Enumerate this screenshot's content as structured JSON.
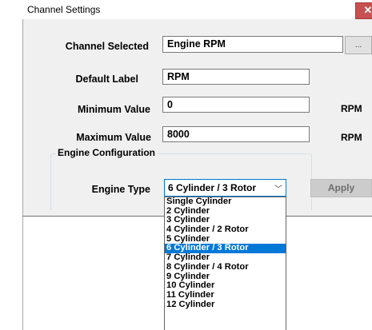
{
  "window": {
    "title": "Channel Settings",
    "close_glyph": "✕"
  },
  "form": {
    "channel_selected": {
      "label": "Channel Selected",
      "value": "Engine RPM",
      "browse_label": "..."
    },
    "default_label": {
      "label": "Default Label",
      "value": "RPM"
    },
    "minimum_value": {
      "label": "Minimum Value",
      "value": "0",
      "unit": "RPM"
    },
    "maximum_value": {
      "label": "Maximum Value",
      "value": "8000",
      "unit": "RPM"
    }
  },
  "engine_config": {
    "group_title": "Engine Configuration",
    "engine_type_label": "Engine Type",
    "selected": "6 Cylinder / 3 Rotor",
    "dropdown_arrow": "﹀",
    "apply_label": "Apply",
    "options": [
      "Single Cylinder",
      "2 Cylinder",
      "3 Cylinder",
      "4 Cylinder / 2 Rotor",
      "5 Cylinder",
      "6 Cylinder / 3 Rotor",
      "7 Cylinder",
      "8 Cylinder / 4 Rotor",
      "9 Cylinder",
      "10 Cylinder",
      "11 Cylinder",
      "12 Cylinder"
    ],
    "selected_index": 5
  },
  "colors": {
    "selection": "#0078d7",
    "close_button": "#c75050",
    "dialog_bg": "#f0f0f0"
  }
}
